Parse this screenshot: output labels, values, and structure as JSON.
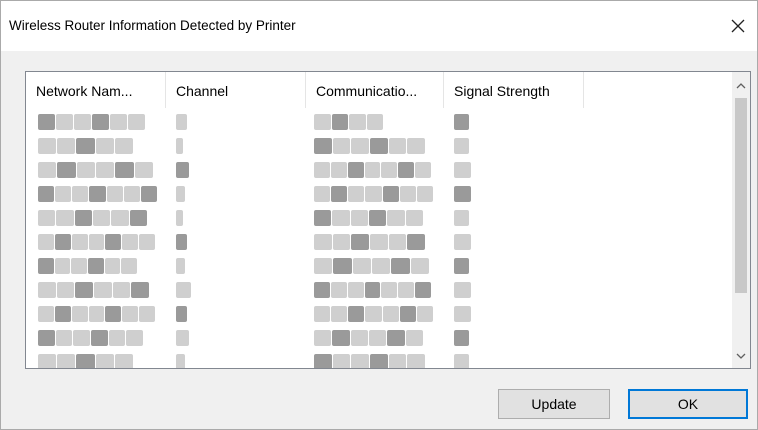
{
  "dialog": {
    "title": "Wireless Router Information Detected by Printer",
    "close_icon": "close-icon"
  },
  "list": {
    "columns": [
      {
        "label": "Network Nam..."
      },
      {
        "label": "Channel"
      },
      {
        "label": "Communicatio..."
      },
      {
        "label": "Signal Strength"
      }
    ],
    "row_count": 11,
    "rows_note": "Row contents are pixelated/obscured in the screenshot"
  },
  "buttons": {
    "update_label": "Update",
    "ok_label": "OK"
  },
  "colors": {
    "accent": "#0078d7",
    "blur_dark": "#9a9a9a",
    "blur_light": "#cfcfcf"
  }
}
